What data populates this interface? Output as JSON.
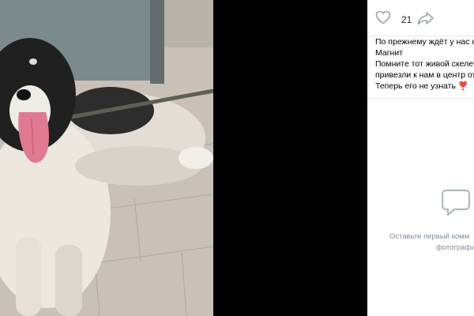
{
  "post": {
    "likes": "21",
    "caption_lines": [
      "По прежнему ждёт у нас св",
      "Магнит",
      "Помните тот живой скелет,",
      "привезли к нам в центр от",
      "Теперь его не узнать ❣️"
    ]
  },
  "comments": {
    "empty_line1": "Оставьте первый комм",
    "empty_line2": "фотографи"
  },
  "icons": {
    "like": "heart-icon",
    "share": "share-arrow-icon",
    "empty": "comment-bubble-icon"
  },
  "colors": {
    "viewer_bg": "#000000",
    "panel_bg": "#ffffff",
    "muted_text": "#818c99",
    "icon_gray": "#99a2ad"
  }
}
